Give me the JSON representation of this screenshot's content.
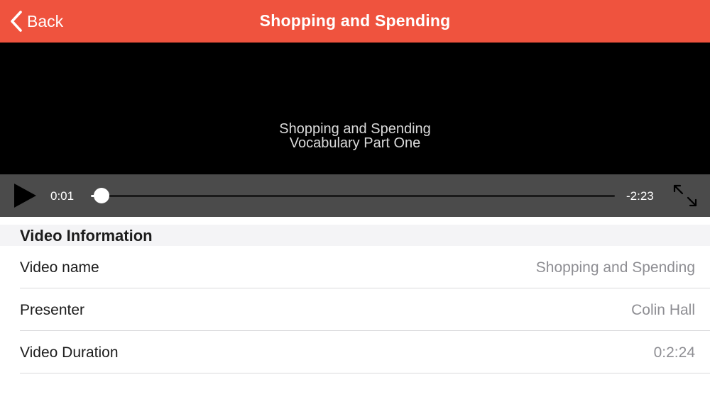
{
  "navbar": {
    "back_label": "Back",
    "title": "Shopping and Spending",
    "background_color": "#ef533e"
  },
  "video": {
    "title_line1": "Shopping and Spending",
    "title_line2": "Vocabulary Part One",
    "elapsed": "0:01",
    "remaining": "-2:23",
    "progress_fraction": 0.007,
    "icons": {
      "play": "play-icon",
      "fullscreen": "fullscreen-expand-icon"
    }
  },
  "info": {
    "section_title": "Video Information",
    "rows": [
      {
        "label": "Video name",
        "value": "Shopping and Spending"
      },
      {
        "label": "Presenter",
        "value": "Colin Hall"
      },
      {
        "label": "Video Duration",
        "value": "0:2:24"
      }
    ]
  }
}
